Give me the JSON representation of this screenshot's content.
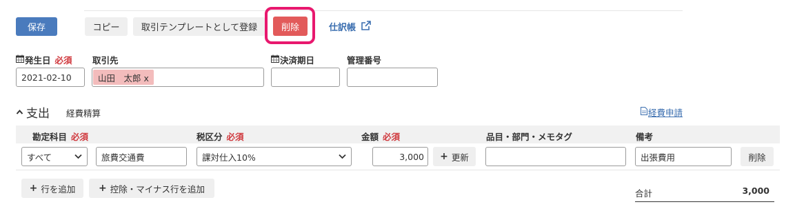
{
  "toolbar": {
    "save_label": "保存",
    "copy_label": "コピー",
    "register_template_label": "取引テンプレートとして登録",
    "delete_label": "削除",
    "journal_link_label": "仕訳帳"
  },
  "header_fields": {
    "issue_date_label": "発生日",
    "issue_date_value": "2021-02-10",
    "partner_label": "取引先",
    "partner_tag": "山田　太郎 x",
    "settlement_date_label": "決済期日",
    "settlement_date_value": "",
    "management_no_label": "管理番号",
    "management_no_value": "",
    "required_label": "必須"
  },
  "section": {
    "title": "支出",
    "subtitle": "経費精算",
    "expense_request_link": "経費申請"
  },
  "table": {
    "headers": {
      "account": "勘定科目",
      "tax": "税区分",
      "amount": "金額",
      "item_memo": "品目・部門・メモタグ",
      "remarks": "備考"
    },
    "rows": [
      {
        "account_filter": "すべて",
        "account": "旅費交通費",
        "tax": "課対仕入10%",
        "amount": "3,000",
        "update_label": "更新",
        "item_memo": "",
        "remarks": "出張費用",
        "delete_label": "削除"
      }
    ]
  },
  "footer": {
    "add_row_label": "行を追加",
    "add_deduction_label": "控除・マイナス行を追加",
    "total_label": "合計",
    "total_value": "3,000"
  },
  "colors": {
    "primary": "#4a7bbd",
    "danger": "#e25a5a",
    "highlight": "#e8186e",
    "required": "#d0393e",
    "link": "#3c6fb0"
  }
}
